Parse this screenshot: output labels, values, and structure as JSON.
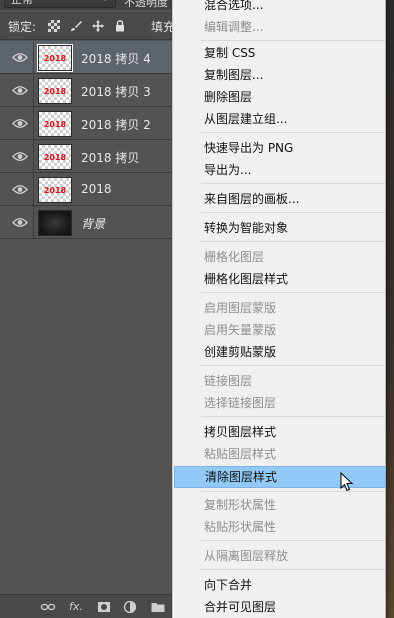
{
  "panel": {
    "blend_mode": "正常",
    "opacity_label": "不透明度",
    "lock_label": "锁定:",
    "fill_label": "填充",
    "layers": [
      {
        "name": "2018 拷贝 4",
        "thumb_text": "2018",
        "selected": true
      },
      {
        "name": "2018 拷贝 3",
        "thumb_text": "2018"
      },
      {
        "name": "2018 拷贝 2",
        "thumb_text": "2018"
      },
      {
        "name": "2018 拷贝",
        "thumb_text": "2018"
      },
      {
        "name": "2018",
        "thumb_text": "2018"
      },
      {
        "name": "背景",
        "thumb_text": ""
      }
    ],
    "bottom_icons": [
      "link-icon",
      "fx-icon",
      "mask-icon",
      "adjustment-icon",
      "group-folder-icon"
    ],
    "bottom_fx": "fx."
  },
  "menu": {
    "items": [
      {
        "label": "混合选项...",
        "disabled": false
      },
      {
        "label": "编辑调整...",
        "disabled": true
      },
      {
        "label": "复制 CSS",
        "disabled": false
      },
      {
        "label": "复制图层...",
        "disabled": false
      },
      {
        "label": "删除图层",
        "disabled": false
      },
      {
        "label": "从图层建立组...",
        "disabled": false
      },
      {
        "label": "快速导出为 PNG",
        "disabled": false
      },
      {
        "label": "导出为...",
        "disabled": false
      },
      {
        "label": "来自图层的画板...",
        "disabled": false
      },
      {
        "label": "转换为智能对象",
        "disabled": false
      },
      {
        "label": "栅格化图层",
        "disabled": true
      },
      {
        "label": "栅格化图层样式",
        "disabled": false
      },
      {
        "label": "启用图层蒙版",
        "disabled": true
      },
      {
        "label": "启用矢量蒙版",
        "disabled": true
      },
      {
        "label": "创建剪贴蒙版",
        "disabled": false
      },
      {
        "label": "链接图层",
        "disabled": true
      },
      {
        "label": "选择链接图层",
        "disabled": true
      },
      {
        "label": "拷贝图层样式",
        "disabled": false
      },
      {
        "label": "粘贴图层样式",
        "disabled": true
      },
      {
        "label": "清除图层样式",
        "disabled": false,
        "highlighted": true
      },
      {
        "label": "复制形状属性",
        "disabled": true
      },
      {
        "label": "粘贴形状属性",
        "disabled": true
      },
      {
        "label": "从隔离图层释放",
        "disabled": true
      },
      {
        "label": "向下合并",
        "disabled": false
      },
      {
        "label": "合并可见图层",
        "disabled": false
      }
    ]
  },
  "colors": {
    "panel_bg": "#535353",
    "selected_row": "#5e646c",
    "menu_bg": "#f0f0f0",
    "menu_highlight": "#91c9f7",
    "disabled_text": "#8e8e8e",
    "thumb_text": "#d4121b"
  }
}
